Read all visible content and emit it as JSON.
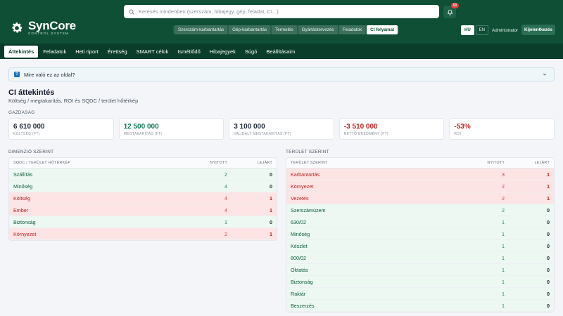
{
  "brand": {
    "name": "SynCore",
    "subtitle": "CONTROL SYSTEM"
  },
  "search": {
    "placeholder": "Keresés mindenben (szerszám, hibajegy, gép, feladat, CI...)"
  },
  "notifications": {
    "count": "53"
  },
  "modules": [
    {
      "label": "Szerszám-karbantartás",
      "active": false
    },
    {
      "label": "Gép-karbantartás",
      "active": false
    },
    {
      "label": "Termelés",
      "active": false
    },
    {
      "label": "Gyártástervezés",
      "active": false
    },
    {
      "label": "Feladatok",
      "active": false
    },
    {
      "label": "CI folyamat",
      "active": true
    }
  ],
  "languages": [
    {
      "label": "HU",
      "active": true
    },
    {
      "label": "EN",
      "active": false
    }
  ],
  "user": {
    "name": "Administrator",
    "logout_label": "Kijelentkezés"
  },
  "nav": [
    {
      "label": "Áttekintés",
      "active": true
    },
    {
      "label": "Feladatok",
      "active": false
    },
    {
      "label": "Heti riport",
      "active": false
    },
    {
      "label": "Érettség",
      "active": false
    },
    {
      "label": "SMART célok",
      "active": false
    },
    {
      "label": "Ismétlődő",
      "active": false
    },
    {
      "label": "Hibajegyek",
      "active": false
    },
    {
      "label": "Súgó",
      "active": false
    },
    {
      "label": "Beállításaim",
      "active": false
    }
  ],
  "help": {
    "text": "Mire való ez az oldal?"
  },
  "page": {
    "title": "CI áttekintés",
    "subtitle": "Költség / megtakarítás, ROI és SQDC / terület hőtérkép"
  },
  "economy": {
    "label": "Gazdaság",
    "cards": [
      {
        "value": "6 610 000",
        "label": "Költség (Ft)",
        "tone": "dark"
      },
      {
        "value": "12 500 000",
        "label": "Megtakarítás (Ft)",
        "tone": "green"
      },
      {
        "value": "3 100 000",
        "label": "Validált megtakarítás (Ft)",
        "tone": "dark"
      },
      {
        "value": "-3 510 000",
        "label": "Nettó eredmény (Ft)",
        "tone": "red"
      },
      {
        "value": "-53%",
        "label": "ROI",
        "tone": "red"
      }
    ]
  },
  "dimension": {
    "label": "Dimenzió szerint",
    "headers": [
      "SQDC / terület hőtérkép",
      "Nyitott",
      "Lejárt"
    ],
    "rows": [
      {
        "name": "Szállítás",
        "open": "2",
        "overdue": "0",
        "status": "good"
      },
      {
        "name": "Minőség",
        "open": "4",
        "overdue": "0",
        "status": "good"
      },
      {
        "name": "Költség",
        "open": "4",
        "overdue": "1",
        "status": "bad"
      },
      {
        "name": "Ember",
        "open": "4",
        "overdue": "1",
        "status": "bad"
      },
      {
        "name": "Biztonság",
        "open": "1",
        "overdue": "0",
        "status": "good"
      },
      {
        "name": "Környezet",
        "open": "2",
        "overdue": "1",
        "status": "bad"
      }
    ]
  },
  "area": {
    "label": "Terület szerint",
    "headers": [
      "Terület szerint",
      "Nyitott",
      "Lejárt"
    ],
    "rows": [
      {
        "name": "Karbantartás",
        "open": "3",
        "overdue": "1",
        "status": "bad"
      },
      {
        "name": "Környezet",
        "open": "2",
        "overdue": "1",
        "status": "bad"
      },
      {
        "name": "Vezetés",
        "open": "2",
        "overdue": "1",
        "status": "bad"
      },
      {
        "name": "Szerszámüzem",
        "open": "2",
        "overdue": "0",
        "status": "good"
      },
      {
        "name": "630/02",
        "open": "1",
        "overdue": "0",
        "status": "good"
      },
      {
        "name": "Minőség",
        "open": "1",
        "overdue": "0",
        "status": "good"
      },
      {
        "name": "Készlet",
        "open": "1",
        "overdue": "0",
        "status": "good"
      },
      {
        "name": "800/02",
        "open": "1",
        "overdue": "0",
        "status": "good"
      },
      {
        "name": "Oktatás",
        "open": "1",
        "overdue": "0",
        "status": "good"
      },
      {
        "name": "Biztonság",
        "open": "1",
        "overdue": "0",
        "status": "good"
      },
      {
        "name": "Raktár",
        "open": "1",
        "overdue": "0",
        "status": "good"
      },
      {
        "name": "Beszerzés",
        "open": "1",
        "overdue": "0",
        "status": "good"
      }
    ]
  }
}
